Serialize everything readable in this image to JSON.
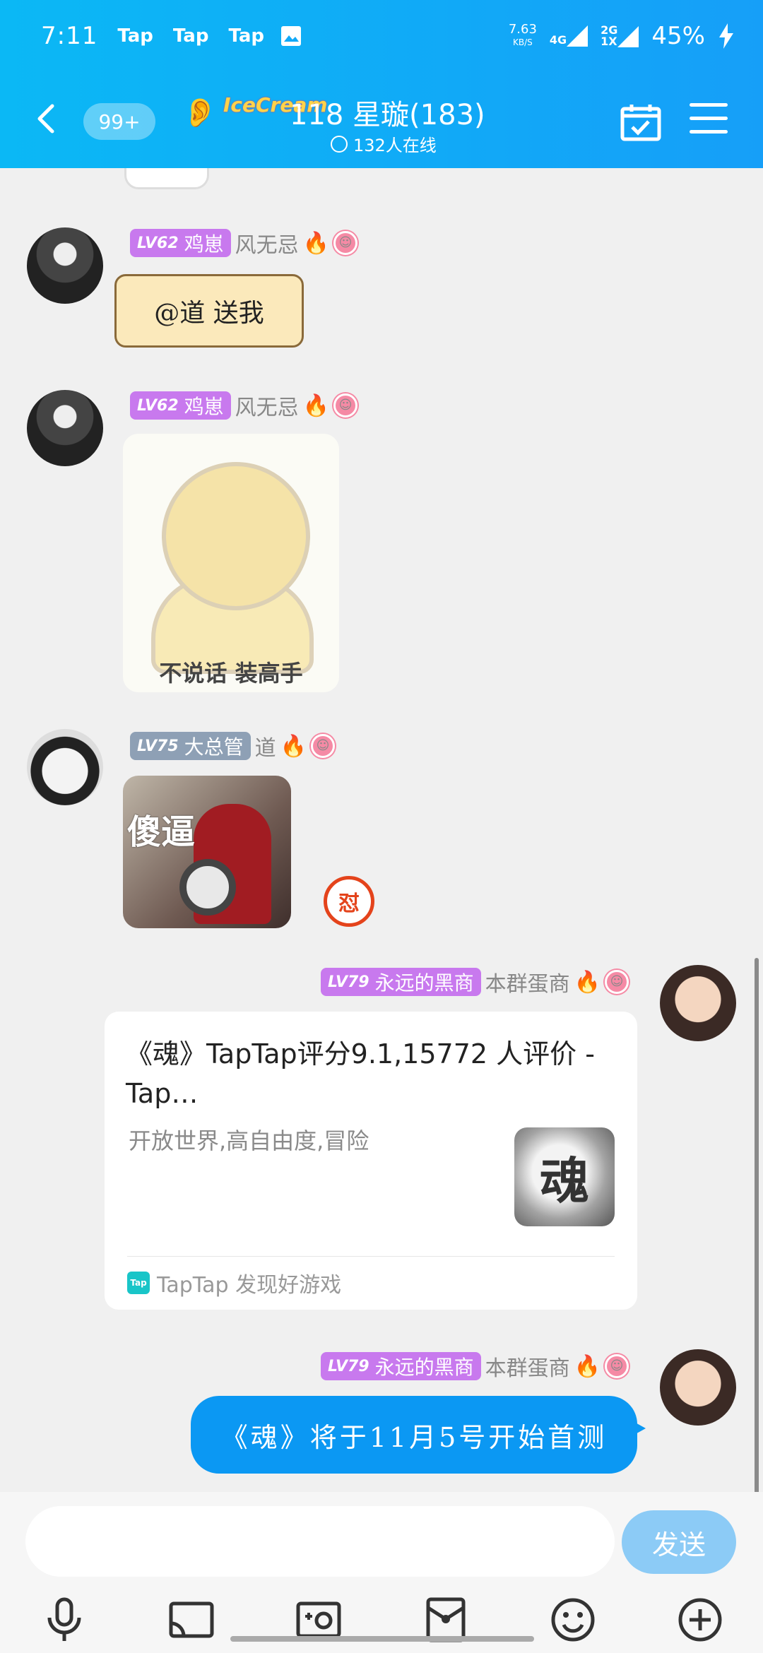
{
  "status_bar": {
    "time": "7:11",
    "tap_labels": [
      "Tap",
      "Tap",
      "Tap"
    ],
    "net_speed": "7.63",
    "net_unit": "KB/S",
    "sig1": "4G",
    "sig2": "2G",
    "sig2b": "1X",
    "battery": "45%"
  },
  "header": {
    "unread": "99+",
    "logo": "IceCream",
    "title": "118 星璇(183)",
    "online": "132人在线"
  },
  "messages": [
    {
      "level": "LV62",
      "title_tag": "鸡崽",
      "name": "风无忌",
      "text": "@道 送我"
    },
    {
      "level": "LV62",
      "title_tag": "鸡崽",
      "name": "风无忌",
      "sticker_caption": "不说话 装高手"
    },
    {
      "level": "LV75",
      "title_tag": "大总管",
      "name": "道",
      "sticker_caption": "傻逼",
      "reaction": "怼"
    },
    {
      "level": "LV79",
      "title_tag": "永远的黑商",
      "name": "本群蛋商",
      "card": {
        "title": "《魂》TapTap评分9.1,15772 人评价 - Tap…",
        "desc": "开放世界,高自由度,冒险",
        "thumb": "魂",
        "source": "TapTap 发现好游戏",
        "source_icon": "Tap"
      }
    },
    {
      "level": "LV79",
      "title_tag": "永远的黑商",
      "name": "本群蛋商",
      "text": "《魂》将于11月5号开始首测"
    }
  ],
  "input": {
    "placeholder": "",
    "send_label": "发送"
  },
  "icons": [
    "mic-icon",
    "cast-icon",
    "photo-icon",
    "red-packet-icon",
    "emoji-icon",
    "plus-icon"
  ],
  "colors": {
    "header": "#11a9f7",
    "bubble": "#0b98f3",
    "lv_purple": "#c879ee",
    "lv_gray": "#8ea0b5"
  }
}
